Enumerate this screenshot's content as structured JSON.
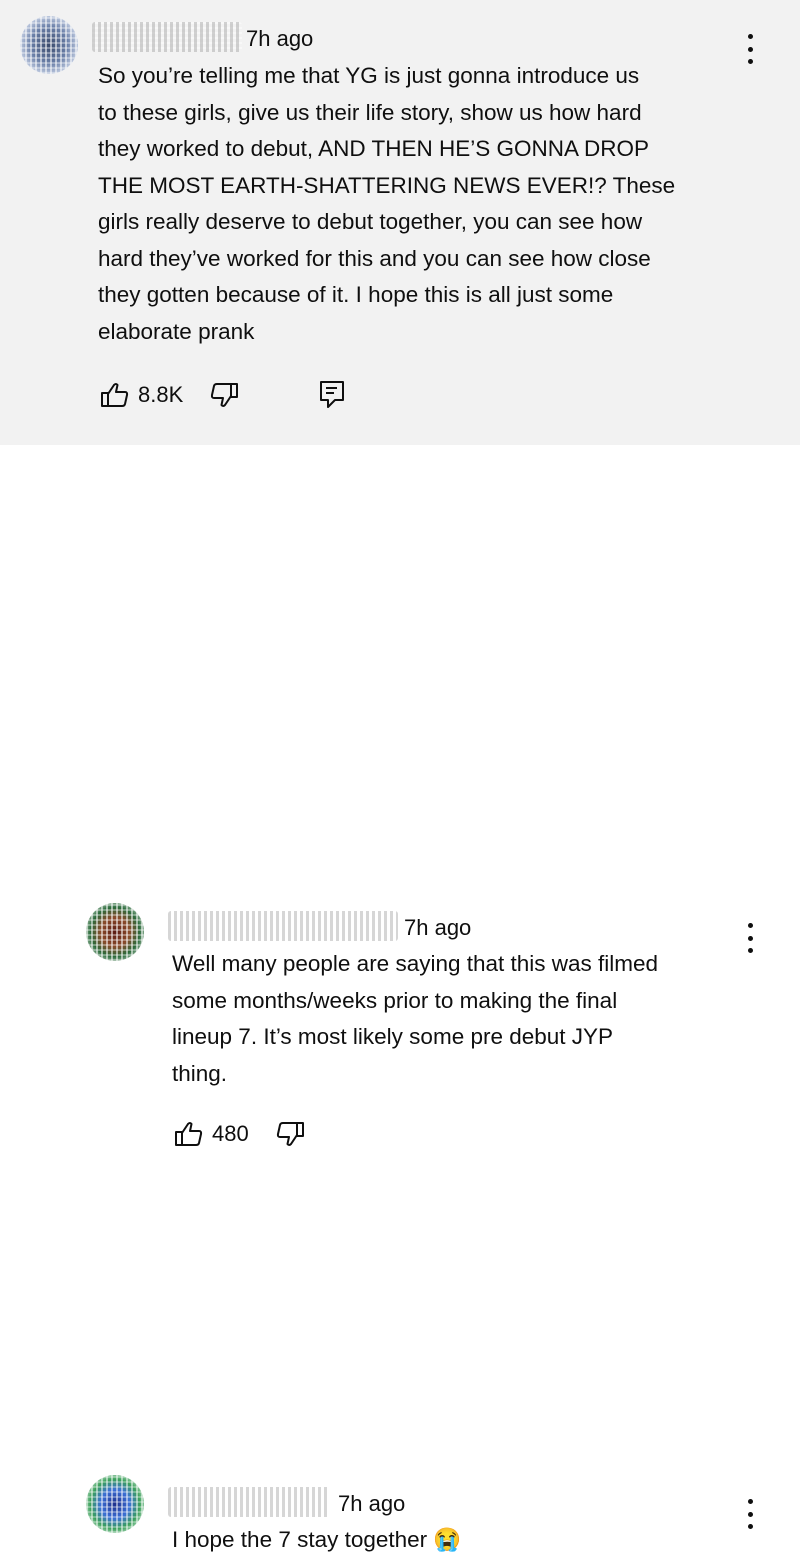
{
  "comments": [
    {
      "time": "7h ago",
      "text": "So you’re telling me that YG is just gonna introduce us\nto these girls, give us their life story, show us how hard\nthey worked to debut, AND THEN HE’S GONNA DROP\nTHE MOST EARTH-SHATTERING NEWS EVER!? These\ngirls really deserve to debut together, you can see how\nhard they’ve worked for this and you can see how close\nthey gotten because of it. I hope this is all just some\nelaborate prank",
      "likes": "8.8K",
      "highlighted": true
    },
    {
      "time": "7h ago",
      "text": "Well many people are saying that this was filmed\nsome months/weeks prior to making the final\nlineup 7. It’s most likely some pre debut JYP\nthing.",
      "likes": "480"
    },
    {
      "time": "7h ago",
      "text": "I hope the 7 stay together 😭"
    }
  ],
  "icons": {
    "like": "thumbs-up-icon",
    "dislike": "thumbs-down-icon",
    "reply": "reply-icon",
    "more": "more-vertical-icon"
  },
  "colors": {
    "highlight_bg": "#f2f2f2",
    "text": "#0f0f0f"
  }
}
